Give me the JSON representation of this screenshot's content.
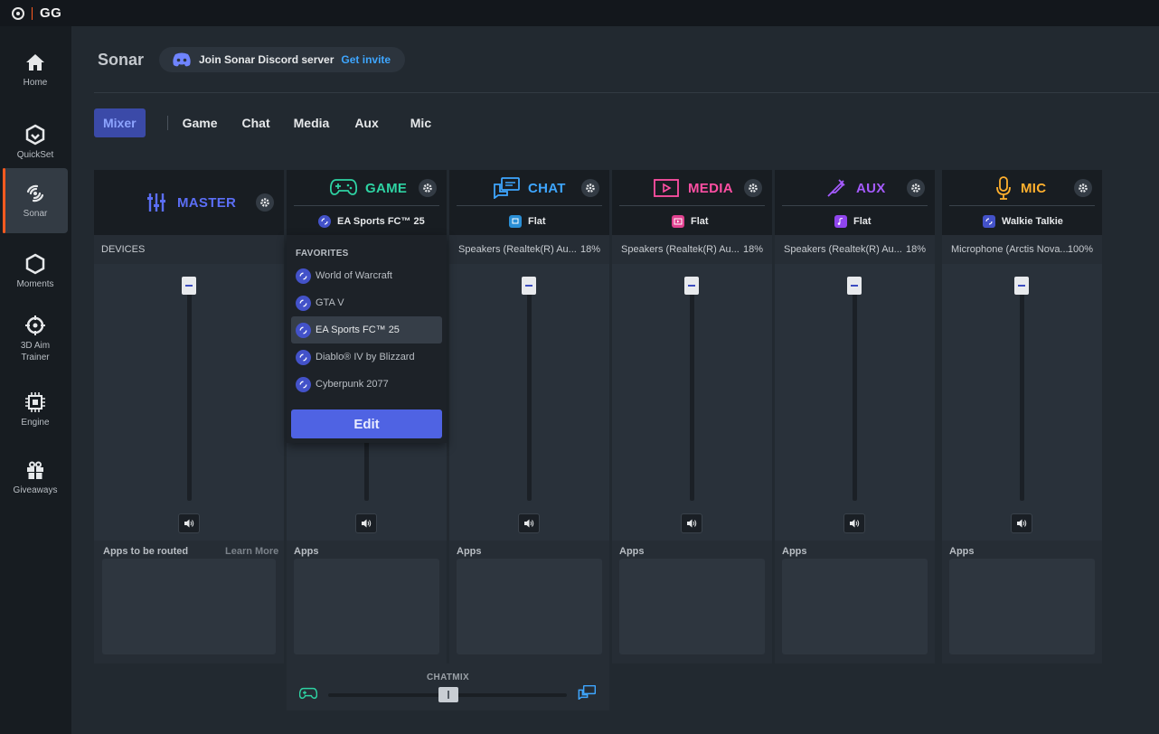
{
  "app": {
    "logo_text": "GG"
  },
  "sidebar": {
    "items": [
      {
        "label": "Home",
        "icon": "home-icon"
      },
      {
        "label": "QuickSet",
        "icon": "quickset-icon"
      },
      {
        "label": "Sonar",
        "icon": "sonar-icon",
        "active": true
      },
      {
        "label": "Moments",
        "icon": "moments-icon"
      },
      {
        "label": "3D Aim\nTrainer",
        "icon": "aim-trainer-icon"
      },
      {
        "label": "Engine",
        "icon": "engine-icon"
      },
      {
        "label": "Giveaways",
        "icon": "gift-icon"
      }
    ]
  },
  "header": {
    "title": "Sonar",
    "discord_text": "Join Sonar Discord server",
    "discord_link": "Get invite"
  },
  "tabs": [
    "Mixer",
    "Game",
    "Chat",
    "Media",
    "Aux",
    "Mic"
  ],
  "active_tab": "Mixer",
  "colors": {
    "accent": "#4f63e3",
    "master": "#5b6ef5",
    "game": "#2ed3a3",
    "chat": "#3ea6ff",
    "media": "#ff4fa3",
    "aux": "#a55bff",
    "mic": "#ffb02e",
    "brand": "#ff5a1f"
  },
  "channels": {
    "master": {
      "name": "MASTER",
      "devices_label": "DEVICES",
      "apps_label": "Apps to be routed",
      "learn_more": "Learn More"
    },
    "game": {
      "name": "GAME",
      "preset": "EA Sports FC™ 25",
      "apps_label": "Apps"
    },
    "chat": {
      "name": "CHAT",
      "preset": "Flat",
      "device": "Speakers (Realtek(R) Au...",
      "volume": "18%",
      "apps_label": "Apps"
    },
    "media": {
      "name": "MEDIA",
      "preset": "Flat",
      "device": "Speakers (Realtek(R) Au...",
      "volume": "18%",
      "apps_label": "Apps"
    },
    "aux": {
      "name": "AUX",
      "preset": "Flat",
      "device": "Speakers (Realtek(R) Au...",
      "volume": "18%",
      "apps_label": "Apps"
    },
    "mic": {
      "name": "MIC",
      "preset": "Walkie Talkie",
      "device": "Microphone (Arctis Nova...",
      "volume": "100%",
      "apps_label": "Apps"
    }
  },
  "favorites": {
    "title": "FAVORITES",
    "items": [
      "World of Warcraft",
      "GTA V",
      "EA Sports FC™ 25",
      "Diablo® IV by Blizzard",
      "Cyberpunk 2077"
    ],
    "selected": "EA Sports FC™ 25",
    "edit_label": "Edit"
  },
  "chatmix": {
    "label": "CHATMIX",
    "position": 0.5
  }
}
